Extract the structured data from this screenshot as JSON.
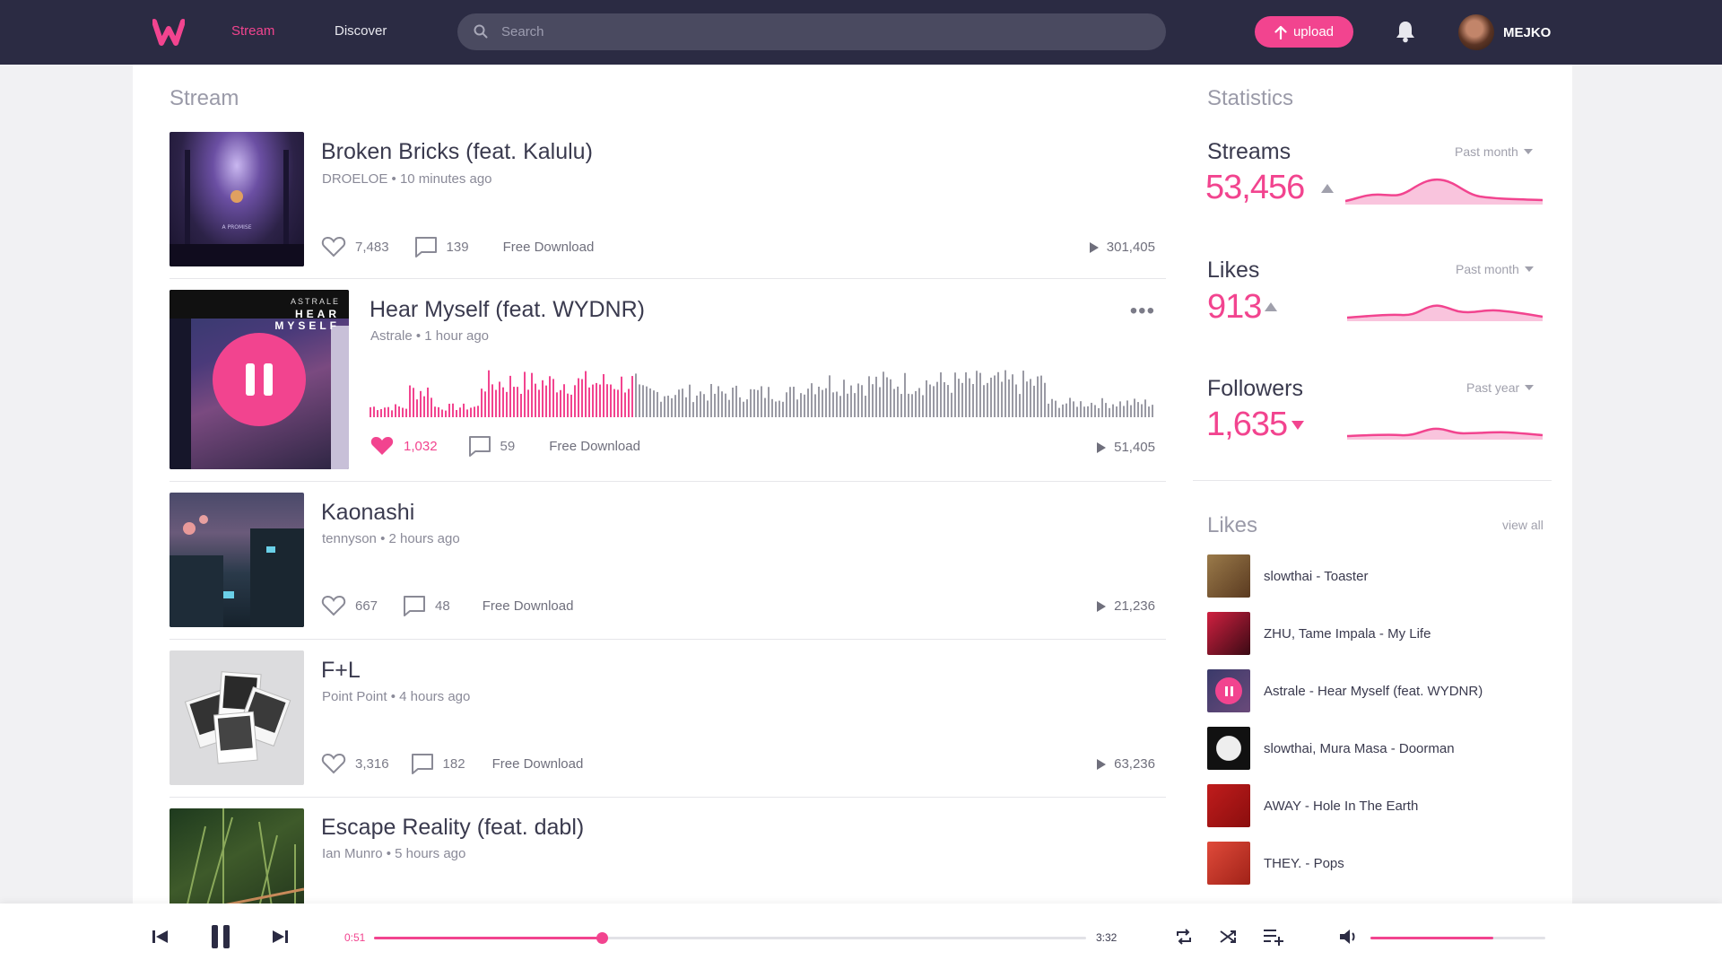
{
  "nav": {
    "links": [
      "Stream",
      "Discover"
    ],
    "search_placeholder": "Search",
    "upload_label": "upload",
    "username": "MEJKO"
  },
  "stream": {
    "heading": "Stream",
    "tracks": [
      {
        "title": "Broken Bricks (feat. Kalulu)",
        "artist": "DROELOE",
        "time": "10 minutes ago",
        "likes": "7,483",
        "comments": "139",
        "download": "Free Download",
        "plays": "301,405"
      },
      {
        "title": "Hear Myself (feat. WYDNR)",
        "artist": "Astrale",
        "time": "1 hour ago",
        "likes": "1,032",
        "comments": "59",
        "download": "Free Download",
        "plays": "51,405",
        "liked": true,
        "playing": true,
        "played_fraction": 0.34,
        "art_text_1": "ASTRALE",
        "art_text_2": "HEAR",
        "art_text_3": "MYSELF"
      },
      {
        "title": "Kaonashi",
        "artist": "tennyson",
        "time": "2 hours ago",
        "likes": "667",
        "comments": "48",
        "download": "Free Download",
        "plays": "21,236"
      },
      {
        "title": "F+L",
        "artist": "Point Point",
        "time": "4 hours ago",
        "likes": "3,316",
        "comments": "182",
        "download": "Free Download",
        "plays": "63,236"
      },
      {
        "title": "Escape Reality (feat. dabl)",
        "artist": "Ian Munro",
        "time": "5 hours ago"
      }
    ]
  },
  "statistics": {
    "heading": "Statistics",
    "items": [
      {
        "label": "Streams",
        "value": "53,456",
        "period": "Past month",
        "trend": "up"
      },
      {
        "label": "Likes",
        "value": "913",
        "period": "Past month",
        "trend": "up"
      },
      {
        "label": "Followers",
        "value": "1,635",
        "period": "Past year",
        "trend": "down"
      }
    ]
  },
  "likes": {
    "heading": "Likes",
    "view_all": "view all",
    "items": [
      {
        "text": "slowthai - Toaster",
        "color": "#8a6a3a"
      },
      {
        "text": "ZHU, Tame Impala - My Life",
        "color": "#9c1828"
      },
      {
        "text": "Astrale - Hear Myself (feat. WYDNR)",
        "color": "#2a2d55",
        "playing": true
      },
      {
        "text": "slowthai, Mura Masa - Doorman",
        "color": "#1a1a1a"
      },
      {
        "text": "AWAY - Hole In The Earth",
        "color": "#b01818"
      },
      {
        "text": "THEY. - Pops",
        "color": "#d43a30"
      }
    ]
  },
  "player": {
    "elapsed": "0:51",
    "duration": "3:32",
    "progress": 0.32,
    "volume": 0.7
  },
  "colors": {
    "accent": "#f2448f",
    "nav_bg": "#2b2b43"
  }
}
